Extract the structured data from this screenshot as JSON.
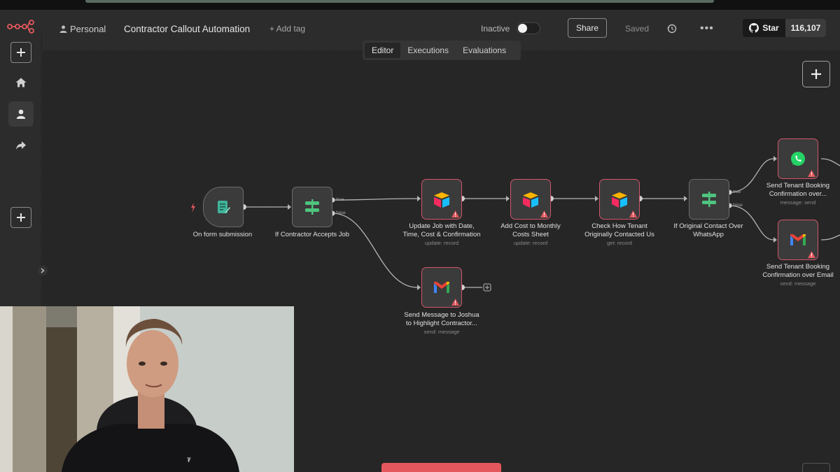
{
  "header": {
    "project_label": "Personal",
    "workflow_name": "Contractor Callout Automation",
    "add_tag": "+ Add tag",
    "status_label": "Inactive",
    "share_label": "Share",
    "saved_label": "Saved",
    "github_star_label": "Star",
    "github_star_count": "116,107"
  },
  "tabs": [
    {
      "label": "Editor",
      "active": true
    },
    {
      "label": "Executions",
      "active": false
    },
    {
      "label": "Evaluations",
      "active": false
    }
  ],
  "sidebar": {
    "items": [
      "add-icon",
      "home-icon",
      "user-icon",
      "share-icon",
      "add-icon"
    ]
  },
  "nodes": {
    "form": {
      "label": "On form submission",
      "sub": ""
    },
    "if_accept": {
      "label": "If Contractor Accepts Job",
      "sub": ""
    },
    "update_job": {
      "label1": "Update Job with Date,",
      "label2": "Time, Cost & Confirmation",
      "sub": "update: record"
    },
    "add_cost": {
      "label1": "Add Cost to Monthly",
      "label2": "Costs Sheet",
      "sub": "update: record"
    },
    "check_tenant": {
      "label1": "Check How Tenant",
      "label2": "Originally Contacted Us",
      "sub": "get: record"
    },
    "if_whatsapp": {
      "label1": "If Original Contact Over",
      "label2": "WhatsApp",
      "sub": ""
    },
    "send_whatsapp": {
      "label1": "Send Tenant Booking",
      "label2": "Confirmation over...",
      "sub": "message: send"
    },
    "send_email": {
      "label1": "Send Tenant Booking",
      "label2": "Confirmation over Email",
      "sub": "send: message"
    },
    "send_joshua": {
      "label1": "Send Message to Joshua",
      "label2": "to Highlight Contractor...",
      "sub": "send: message"
    }
  },
  "ports": {
    "true": "true",
    "false": "false"
  },
  "colors": {
    "accent_red": "#d3556a",
    "canvas": "#262626",
    "toolbar": "#2c2c2c",
    "node_border": "#6b6b6b",
    "connector": "#b5b5b5"
  }
}
